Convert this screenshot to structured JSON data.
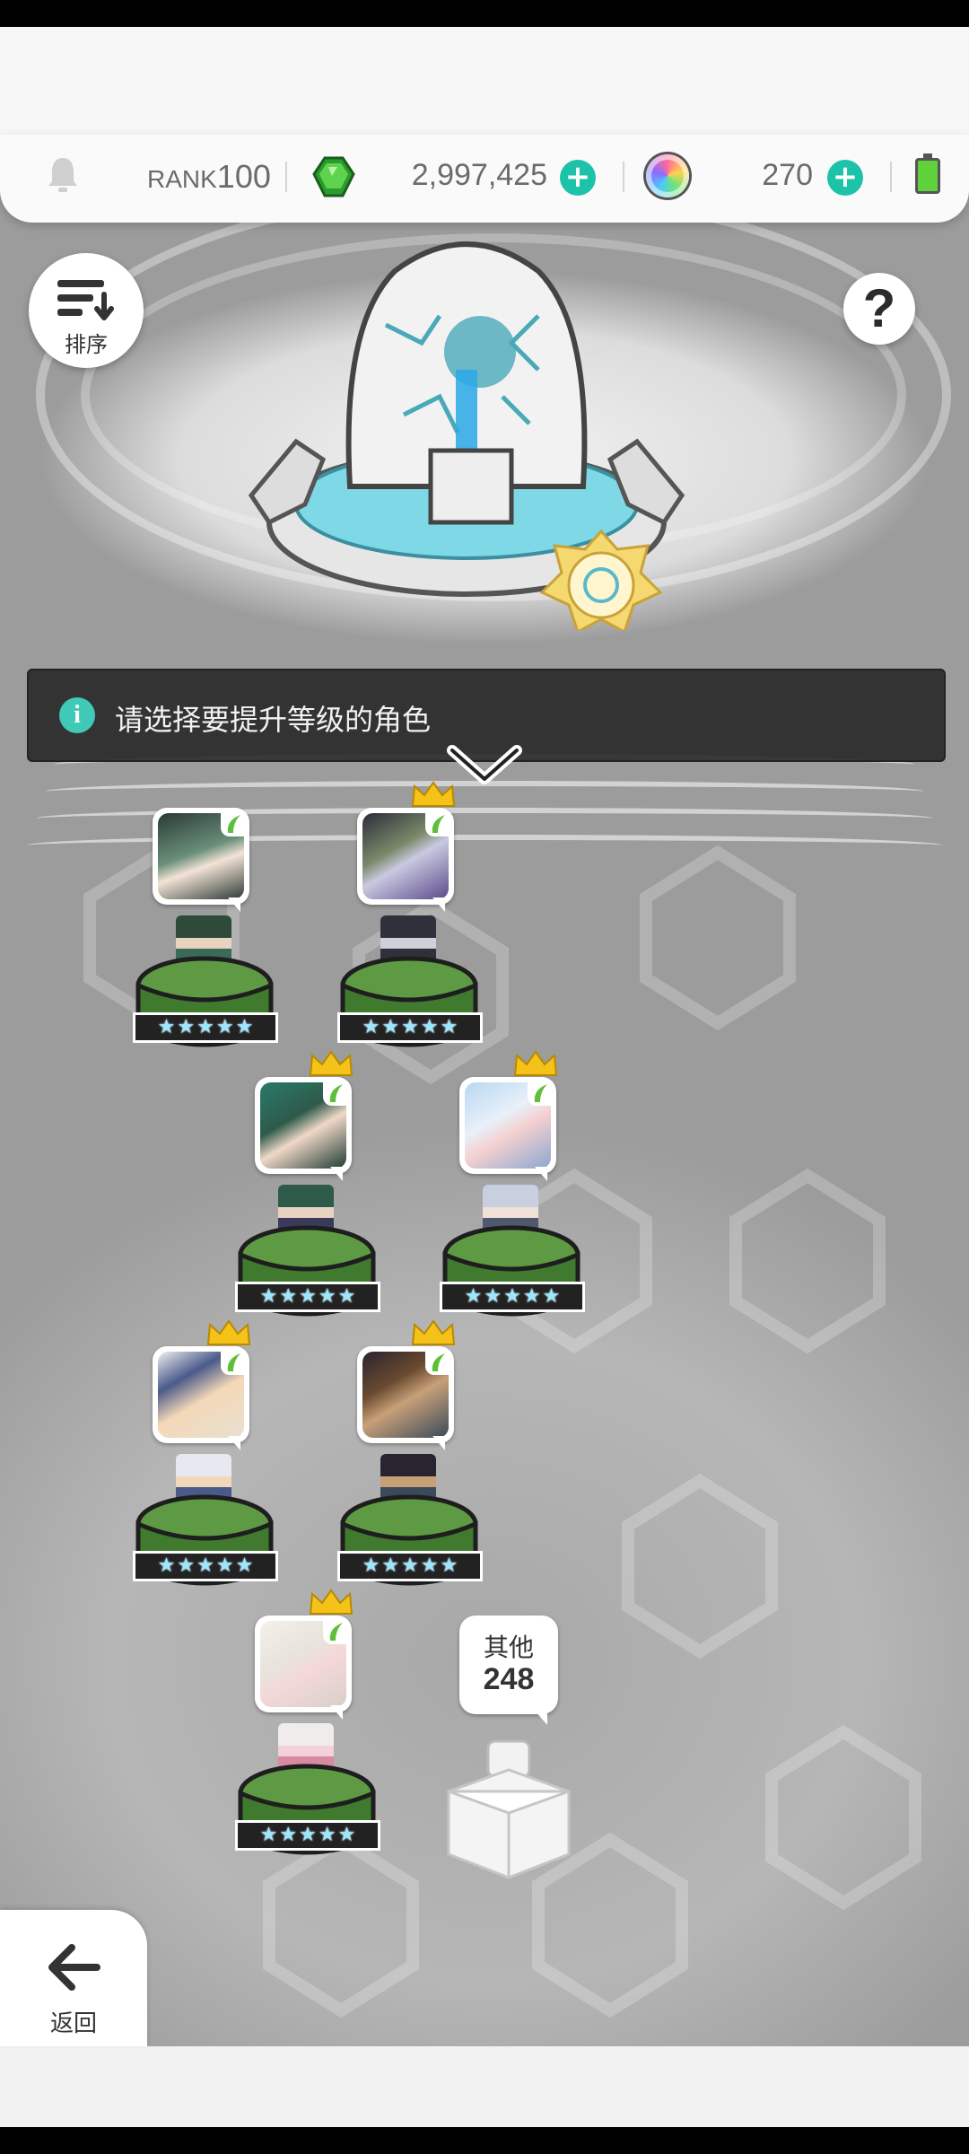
{
  "header": {
    "rank_label": "RANK",
    "rank_value": "100",
    "gems": "2,997,425",
    "orbs": "270"
  },
  "controls": {
    "sort_label": "排序",
    "help_label": "?",
    "back_label": "返回"
  },
  "banner": {
    "text": "请选择要提升等级的角色"
  },
  "characters": [
    {
      "id": "char-1",
      "crown": false,
      "stars": 5
    },
    {
      "id": "char-2",
      "crown": true,
      "stars": 5
    },
    {
      "id": "char-3",
      "crown": true,
      "stars": 5
    },
    {
      "id": "char-4",
      "crown": true,
      "stars": 5
    },
    {
      "id": "char-5",
      "crown": true,
      "stars": 5
    },
    {
      "id": "char-6",
      "crown": true,
      "stars": 5
    },
    {
      "id": "char-7",
      "crown": true,
      "stars": 5
    }
  ],
  "other": {
    "label": "其他",
    "count": "248"
  },
  "icons": [
    "bell-icon",
    "gem-icon",
    "plus-icon",
    "orb-icon",
    "battery-icon",
    "sort-icon",
    "help-icon",
    "info-icon",
    "chevron-down-icon",
    "crown-icon",
    "back-arrow-icon"
  ],
  "colors": {
    "accent": "#1cc3a8",
    "banner_bg": "#282828",
    "pedestal_green": "#4e8a3a"
  }
}
